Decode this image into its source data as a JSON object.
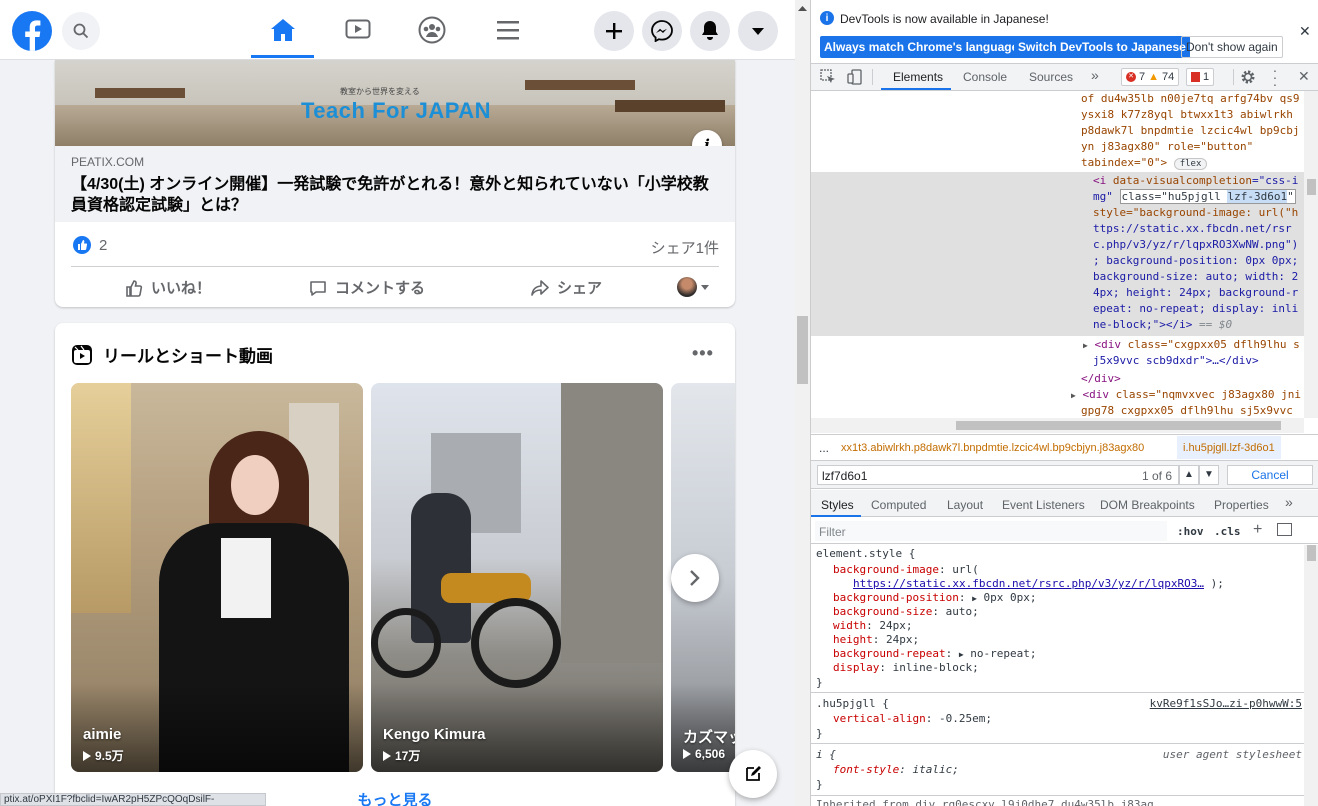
{
  "facebook": {
    "post": {
      "image_caption_small": "教室から世界を変える",
      "image_logo": "Teach For JAPAN",
      "info_icon": "info-icon",
      "domain": "PEATIX.COM",
      "title": "【4/30(土) オンライン開催】一発試験で免許がとれる！意外と知られていない「小学校教員資格認定試験」とは？",
      "likes": "2",
      "shares": "シェア1件",
      "like_label": "いいね！",
      "comment_label": "コメントする",
      "share_label": "シェア"
    },
    "reels": {
      "title": "リールとショート動画",
      "items": [
        {
          "name": "aimie",
          "views": "9.5万"
        },
        {
          "name": "Kengo Kimura",
          "views": "17万"
        },
        {
          "name": "カズマッ",
          "views": "6,506"
        }
      ],
      "see_more": "もっと見る"
    },
    "status_url": "ptix.at/oPXI1F?fbclid=IwAR2pH5ZPcQOqDsilF-"
  },
  "devtools": {
    "banner": {
      "message": "DevTools is now available in Japanese!",
      "btn_match": "Always match Chrome's language",
      "btn_switch": "Switch DevTools to Japanese",
      "btn_dont": "Don't show again"
    },
    "tabs": {
      "elements": "Elements",
      "console": "Console",
      "sources": "Sources"
    },
    "errors": "7",
    "warnings": "74",
    "issues": "1",
    "dom": {
      "l1": "of du4w35lb n00je7tq arfg74bv qs9",
      "l2": "ysxi8 k77z8yql btwxx1t3 abiwlrkh",
      "l3": "p8dawk7l bnpdmtie lzcic4wl bp9cbj",
      "l4_pre": "yn j83agx80\" role=\"button\"",
      "l5": "tabindex=\"0\">",
      "flex": "flex",
      "s1a": "<i ",
      "s1b": "data-visualcompletion",
      "s1c": "=\"css-i",
      "s2a": "mg\" ",
      "s2b": "class=\"hu5pjgll ",
      "s2c": "lzf-3d6o1",
      "s2d": "\"",
      "s3": "style=\"background-image: url(\"h",
      "s4": "ttps://static.xx.fbcdn.net/rsr",
      "s5": "c.php/v3/yz/r/lqpxRO3XwNW.png\")",
      "s6": "; background-position: 0px 0px;",
      "s7": " background-size: auto; width: 2",
      "s8": "4px; height: 24px; background-r",
      "s9": "epeat: no-repeat; display: inli",
      "s10a": "ne-block;\"></i>",
      "s10b": " == $0",
      "d1a": "<div ",
      "d1b": "class=\"cxgpxx05 dflh9lhu s",
      "d2": "j5x9vvc scb9dxdr\">…</div>",
      "d3": "</div>",
      "d4a": "<div ",
      "d4b": "class=\"nqmvxvec j83agx80 jni",
      "d5": "gpg78 cxgpxx05 dflh9lhu sj5x9vvc"
    },
    "breadcrumb": {
      "dots": "...",
      "c1": "xx1t3.abiwlrkh.p8dawk7l.bnpdmtie.lzcic4wl.bp9cbjyn.j83agx80",
      "c2": "i.hu5pjgll.lzf-3d6o1"
    },
    "search": {
      "query": "lzf7d6o1",
      "count": "1 of 6",
      "cancel": "Cancel"
    },
    "subtabs": {
      "styles": "Styles",
      "computed": "Computed",
      "layout": "Layout",
      "listeners": "Event Listeners",
      "dombp": "DOM Breakpoints",
      "props": "Properties"
    },
    "filter": {
      "placeholder": "Filter",
      "hov": ":hov",
      "cls": ".cls"
    },
    "styles": {
      "el_sel": "element.style {",
      "bg_img_p": "background-image",
      "bg_img_v": "url(",
      "bg_url": "https://static.xx.fbcdn.net/rsrc.php/v3/yz/r/lqpxRO3…",
      "bg_url_end": ");",
      "bg_pos_p": "background-position",
      "bg_pos_v": "0px 0px;",
      "bg_size_p": "background-size",
      "bg_size_v": "auto;",
      "w_p": "width",
      "w_v": "24px;",
      "h_p": "height",
      "h_v": "24px;",
      "bg_rep_p": "background-repeat",
      "bg_rep_v": "no-repeat;",
      "disp_p": "display",
      "disp_v": "inline-block;",
      "close": "}",
      "r2_sel": ".hu5pjgll {",
      "r2_src": "kvRe9f1sSJo…zi-p0hwwW:5",
      "va_p": "vertical-align",
      "va_v": "-0.25em;",
      "r3_sel": "i {",
      "r3_src": "user agent stylesheet",
      "fs_p": "font-style",
      "fs_v": "italic;",
      "inh": "Inherited from div.rq0escxv.l9j0dhe7.du4w35lb.j83ag..."
    }
  }
}
